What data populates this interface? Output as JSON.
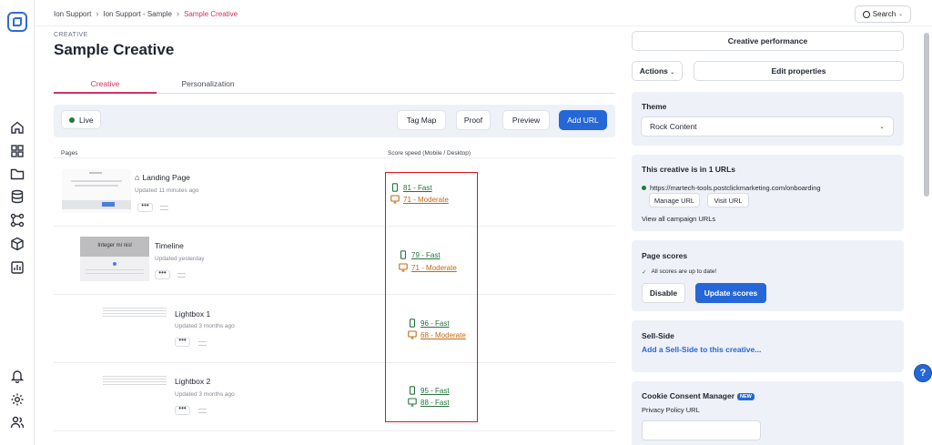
{
  "breadcrumb": {
    "items": [
      "Ion Support",
      "Ion Support - Sample",
      "Sample Creative"
    ]
  },
  "search": {
    "label": "Search"
  },
  "header": {
    "eyebrow": "CREATIVE",
    "title": "Sample Creative"
  },
  "tabs": [
    {
      "label": "Creative",
      "active": true
    },
    {
      "label": "Personalization",
      "active": false
    }
  ],
  "toolbar": {
    "status": "Live",
    "tag_map": "Tag Map",
    "proof": "Proof",
    "preview": "Preview",
    "add_url": "Add URL"
  },
  "table": {
    "col_pages": "Pages",
    "col_score": "Score speed (Mobile / Desktop)",
    "rows": [
      {
        "name": "Landing Page",
        "updated": "Updated 11 minutes ago",
        "mobile": "81 - Fast",
        "desktop": "71 - Moderate",
        "thumb_text": ""
      },
      {
        "name": "Timeline",
        "updated": "Updated yesterday",
        "mobile": "79 - Fast",
        "desktop": "71 - Moderate",
        "thumb_text": "Integer mi nisl"
      },
      {
        "name": "Lightbox 1",
        "updated": "Updated 3 months ago",
        "mobile": "96 - Fast",
        "desktop": "68 - Moderate",
        "thumb_text": ""
      },
      {
        "name": "Lightbox 2",
        "updated": "Updated 3 months ago",
        "mobile": "95 - Fast",
        "desktop": "88 - Fast",
        "thumb_text": ""
      }
    ],
    "more_label": "•••"
  },
  "right": {
    "performance": "Creative performance",
    "actions": "Actions",
    "edit": "Edit properties",
    "theme": {
      "title": "Theme",
      "value": "Rock Content"
    },
    "urls": {
      "title": "This creative is in 1 URLs",
      "url": "https://martech-tools.postclickmarketing.com/onboarding",
      "manage": "Manage URL",
      "visit": "Visit URL",
      "view_all": "View all campaign URLs"
    },
    "scores": {
      "title": "Page scores",
      "status": "All scores are up to date!",
      "disable": "Disable",
      "update": "Update scores"
    },
    "sellside": {
      "title": "Sell-Side",
      "link": "Add a Sell-Side to this creative..."
    },
    "cookie": {
      "title": "Cookie Consent Manager",
      "badge": "NEW",
      "field_label": "Privacy Policy URL",
      "field_value": ""
    }
  },
  "help": "?",
  "colors": {
    "accent": "#d0325e",
    "primary": "#2567d8",
    "fast": "#27733f",
    "moderate": "#c06a10",
    "highlight": "#e0151c"
  },
  "icons": [
    "logo-icon",
    "home-icon",
    "grid-icon",
    "folder-icon",
    "database-icon",
    "workflow-icon",
    "box-icon",
    "chart-icon",
    "bell-icon",
    "gear-icon",
    "users-icon",
    "search-icon",
    "chevron-down-icon",
    "mobile-icon",
    "desktop-icon"
  ]
}
